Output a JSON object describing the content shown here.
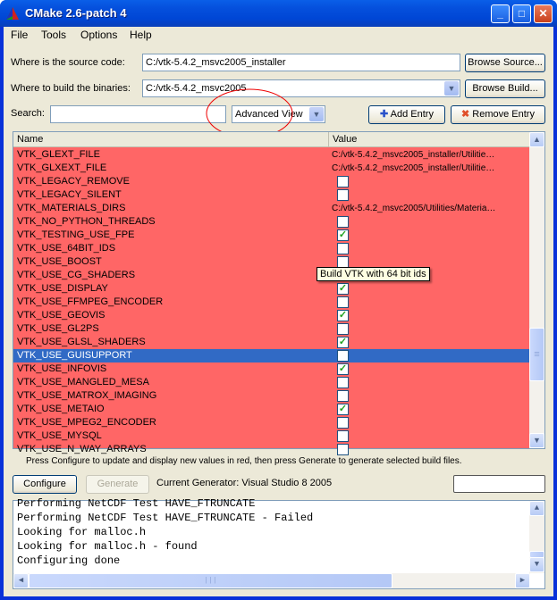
{
  "window": {
    "title": "CMake 2.6-patch 4",
    "minimize": "_",
    "maximize": "□",
    "close": "✕"
  },
  "menu": [
    {
      "label": "File"
    },
    {
      "label": "Tools"
    },
    {
      "label": "Options"
    },
    {
      "label": "Help"
    }
  ],
  "source": {
    "label": "Where is the source code:",
    "value": "C:/vtk-5.4.2_msvc2005_installer",
    "button": "Browse Source..."
  },
  "build": {
    "label": "Where to build the binaries:",
    "value": "C:/vtk-5.4.2_msvc2005",
    "button": "Browse Build..."
  },
  "search": {
    "label": "Search:",
    "value": ""
  },
  "view": {
    "selected": "Advanced View"
  },
  "buttons": {
    "add": "Add Entry",
    "remove": "Remove Entry",
    "configure": "Configure",
    "generate": "Generate"
  },
  "table": {
    "headers": {
      "name": "Name",
      "value": "Value"
    },
    "rows": [
      {
        "name": "VTK_GLEXT_FILE",
        "value": "C:/vtk-5.4.2_msvc2005_installer/Utilitie…"
      },
      {
        "name": "VTK_GLXEXT_FILE",
        "value": "C:/vtk-5.4.2_msvc2005_installer/Utilitie…"
      },
      {
        "name": "VTK_LEGACY_REMOVE",
        "checked": false
      },
      {
        "name": "VTK_LEGACY_SILENT",
        "checked": false
      },
      {
        "name": "VTK_MATERIALS_DIRS",
        "value": "C:/vtk-5.4.2_msvc2005/Utilities/Materia…"
      },
      {
        "name": "VTK_NO_PYTHON_THREADS",
        "checked": false
      },
      {
        "name": "VTK_TESTING_USE_FPE",
        "checked": true
      },
      {
        "name": "VTK_USE_64BIT_IDS",
        "checked": false
      },
      {
        "name": "VTK_USE_BOOST",
        "checked": false
      },
      {
        "name": "VTK_USE_CG_SHADERS",
        "checked": false
      },
      {
        "name": "VTK_USE_DISPLAY",
        "checked": true
      },
      {
        "name": "VTK_USE_FFMPEG_ENCODER",
        "checked": false
      },
      {
        "name": "VTK_USE_GEOVIS",
        "checked": true
      },
      {
        "name": "VTK_USE_GL2PS",
        "checked": false
      },
      {
        "name": "VTK_USE_GLSL_SHADERS",
        "checked": true
      },
      {
        "name": "VTK_USE_GUISUPPORT",
        "checked": false,
        "selected": true
      },
      {
        "name": "VTK_USE_INFOVIS",
        "checked": true
      },
      {
        "name": "VTK_USE_MANGLED_MESA",
        "checked": false
      },
      {
        "name": "VTK_USE_MATROX_IMAGING",
        "checked": false
      },
      {
        "name": "VTK_USE_METAIO",
        "checked": true
      },
      {
        "name": "VTK_USE_MPEG2_ENCODER",
        "checked": false
      },
      {
        "name": "VTK_USE_MYSQL",
        "checked": false
      },
      {
        "name": "VTK_USE_N_WAY_ARRAYS",
        "checked": false
      }
    ]
  },
  "tooltip": "Build VTK with 64 bit ids",
  "hint": "Press Configure to update and display new values in red, then press Generate to generate selected build files.",
  "generator": "Current Generator: Visual Studio 8 2005",
  "log": [
    "Performing NetCDF Test HAVE_FTRUNCATE",
    "Performing NetCDF Test HAVE_FTRUNCATE - Failed",
    "Looking for malloc.h",
    "Looking for malloc.h - found",
    "Configuring done"
  ],
  "colors": {
    "changed_row": "#ff6666",
    "selected_row": "#316ac5"
  }
}
